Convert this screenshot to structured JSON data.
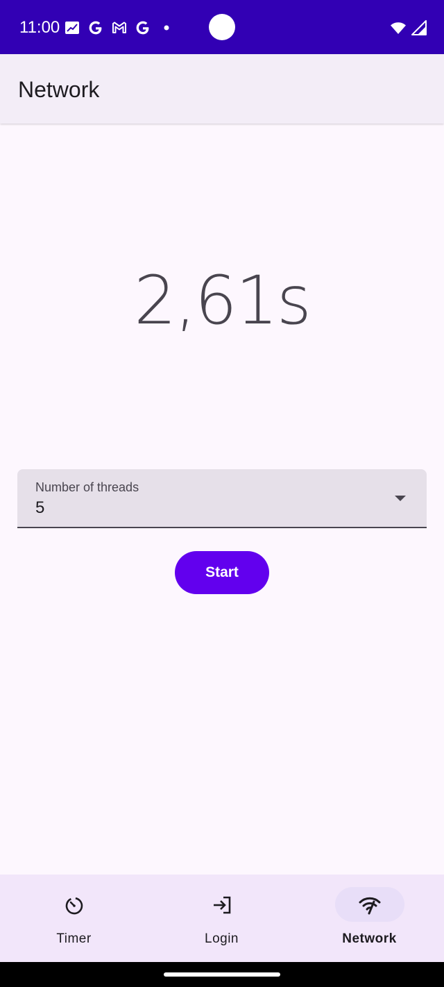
{
  "status_bar": {
    "time": "11:00",
    "icons_left": [
      "stocks-icon",
      "google-icon",
      "gmail-icon",
      "google-icon",
      "dot-icon"
    ],
    "icons_right": [
      "wifi-icon",
      "signal-icon"
    ],
    "background": "#3200b4"
  },
  "app_bar": {
    "title": "Network"
  },
  "main": {
    "elapsed_time": "2,61s",
    "threads_field": {
      "label": "Number of threads",
      "value": "5"
    },
    "start_button": {
      "label": "Start",
      "color": "#6200ee"
    }
  },
  "bottom_nav": {
    "items": [
      {
        "label": "Timer",
        "icon": "timer-icon",
        "active": false
      },
      {
        "label": "Login",
        "icon": "login-icon",
        "active": false
      },
      {
        "label": "Network",
        "icon": "network-check-icon",
        "active": true
      }
    ]
  }
}
